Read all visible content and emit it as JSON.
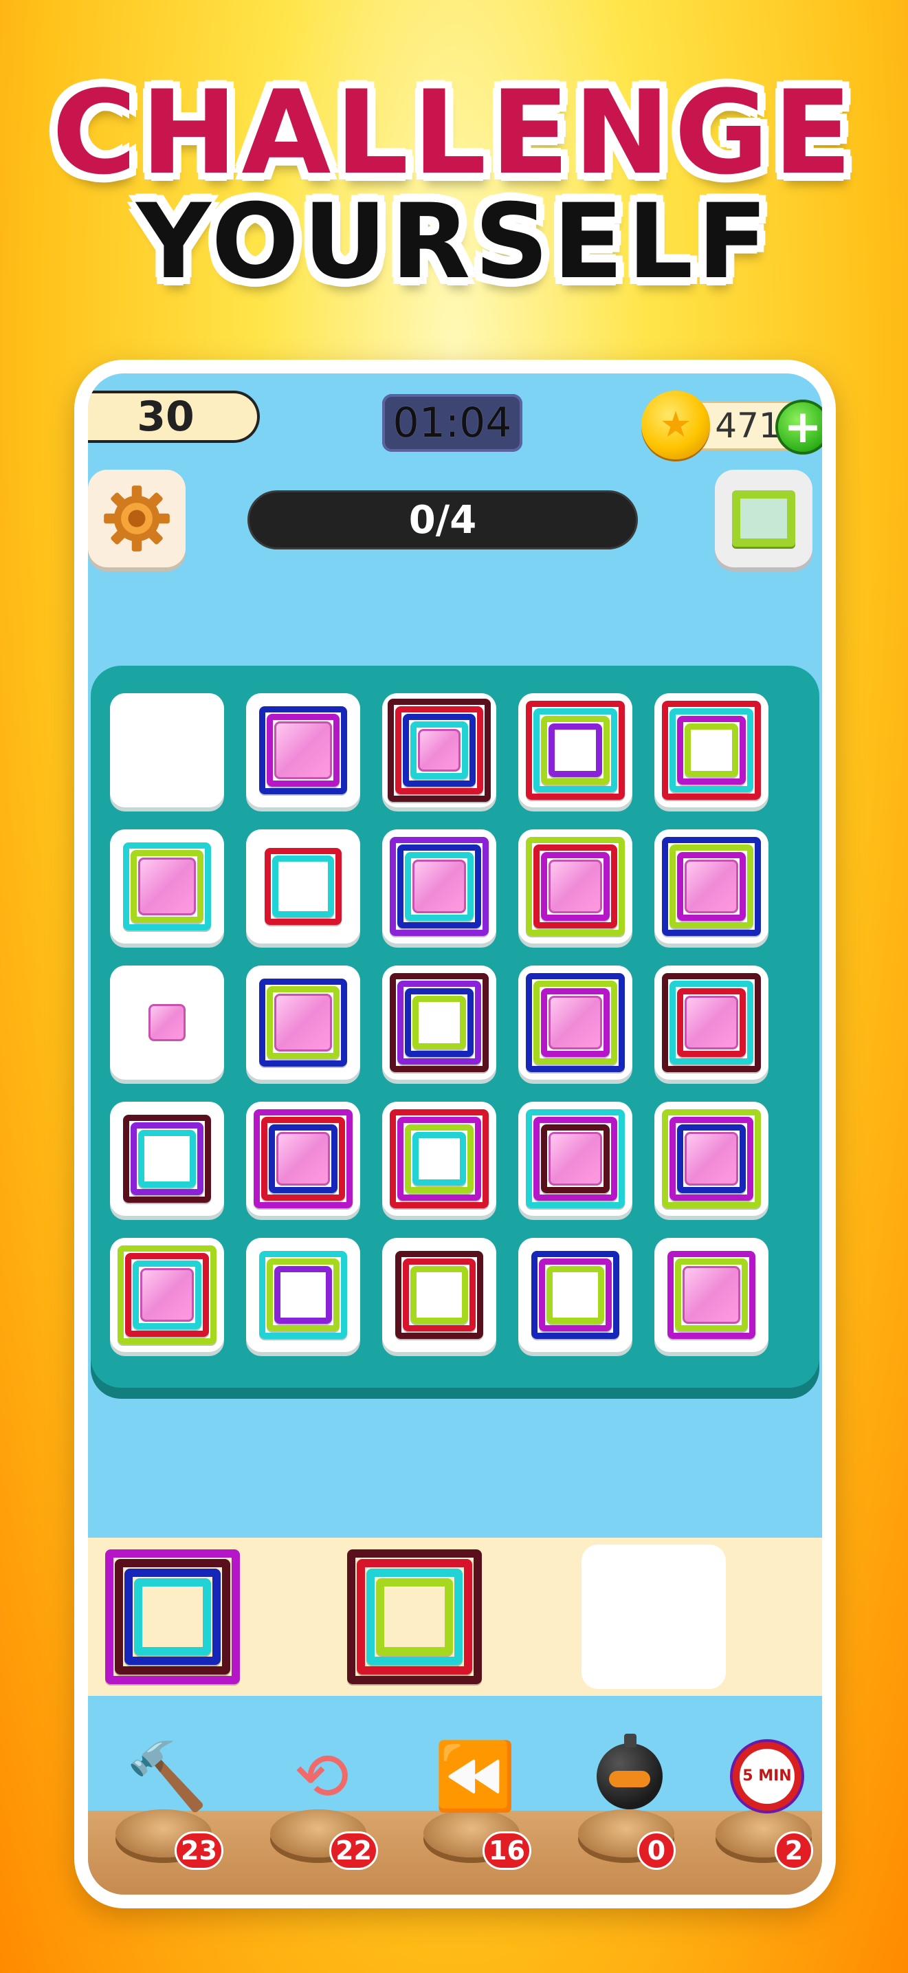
{
  "headline": {
    "line1": "CHALLENGE",
    "line2": "YOURSELF"
  },
  "hud": {
    "level": "30",
    "timer": "01:04",
    "coins": "471",
    "progress": "0/4",
    "settings_icon": "gear-icon",
    "frame_icon": "square-frame-icon",
    "add_icon": "plus-icon",
    "coin_icon": "star-coin-icon"
  },
  "colors": {
    "magenta": "#b416c8",
    "blue": "#1626b8",
    "maroon": "#5a0f1c",
    "cyan": "#22d3d6",
    "red": "#d8142c",
    "lime": "#a6d81e",
    "purple": "#8a22d8",
    "pink": "#f08ad8",
    "teal": "#1aa5a3"
  },
  "board_tiles": [
    [
      [],
      [
        "blue",
        "magenta",
        "pink"
      ],
      [
        "maroon",
        "red",
        "blue",
        "cyan",
        "pink"
      ],
      [
        "red",
        "cyan",
        "lime",
        "purple"
      ],
      [
        "red",
        "cyan",
        "magenta",
        "lime"
      ]
    ],
    [
      [
        "cyan",
        "lime",
        "pink"
      ],
      [
        "red",
        "cyan"
      ],
      [
        "purple",
        "blue",
        "cyan",
        "pink"
      ],
      [
        "lime",
        "red",
        "magenta",
        "pink"
      ],
      [
        "blue",
        "lime",
        "magenta",
        "pink"
      ]
    ],
    [
      [
        "pink"
      ],
      [
        "blue",
        "lime",
        "pink"
      ],
      [
        "maroon",
        "purple",
        "blue",
        "lime"
      ],
      [
        "blue",
        "lime",
        "magenta",
        "pink"
      ],
      [
        "maroon",
        "cyan",
        "red",
        "pink"
      ]
    ],
    [
      [
        "maroon",
        "purple",
        "cyan"
      ],
      [
        "magenta",
        "red",
        "blue",
        "pink"
      ],
      [
        "red",
        "magenta",
        "lime",
        "cyan"
      ],
      [
        "cyan",
        "magenta",
        "maroon",
        "pink"
      ],
      [
        "lime",
        "magenta",
        "blue",
        "pink"
      ]
    ],
    [
      [
        "lime",
        "red",
        "cyan",
        "pink"
      ],
      [
        "cyan",
        "lime",
        "purple"
      ],
      [
        "maroon",
        "red",
        "lime"
      ],
      [
        "blue",
        "magenta",
        "lime"
      ],
      [
        "magenta",
        "lime",
        "pink"
      ]
    ]
  ],
  "tray_slots": [
    [
      "magenta",
      "maroon",
      "blue",
      "cyan"
    ],
    [
      "maroon",
      "red",
      "cyan",
      "lime"
    ],
    []
  ],
  "boosters": [
    {
      "name": "hammer",
      "icon": "hammer-icon",
      "count": "23"
    },
    {
      "name": "shuffle",
      "icon": "shuffle-icon",
      "count": "22"
    },
    {
      "name": "undo",
      "icon": "rewind-icon",
      "count": "16"
    },
    {
      "name": "bomb",
      "icon": "bomb-icon",
      "count": "0"
    },
    {
      "name": "timer",
      "icon": "stopwatch-icon",
      "count": "2",
      "label": "5 MIN"
    }
  ]
}
